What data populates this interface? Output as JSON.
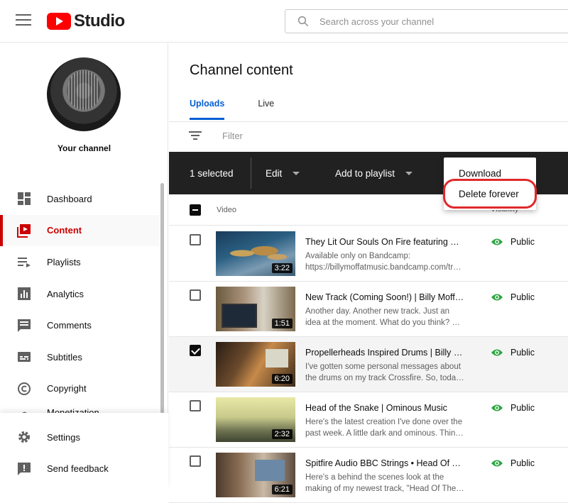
{
  "app": {
    "logo_text": "Studio"
  },
  "search": {
    "placeholder": "Search across your channel"
  },
  "sidebar": {
    "channel_label": "Your channel",
    "items": [
      {
        "label": "Dashboard",
        "icon": "dashboard-icon"
      },
      {
        "label": "Content",
        "icon": "content-icon",
        "active": true
      },
      {
        "label": "Playlists",
        "icon": "playlists-icon"
      },
      {
        "label": "Analytics",
        "icon": "analytics-icon"
      },
      {
        "label": "Comments",
        "icon": "comments-icon"
      },
      {
        "label": "Subtitles",
        "icon": "subtitles-icon"
      },
      {
        "label": "Copyright",
        "icon": "copyright-icon"
      },
      {
        "label": "Monetization",
        "icon": "monetization-icon"
      }
    ],
    "bottom": [
      {
        "label": "Settings",
        "icon": "gear-icon"
      },
      {
        "label": "Send feedback",
        "icon": "feedback-icon"
      }
    ]
  },
  "main": {
    "title": "Channel content",
    "tabs": [
      {
        "label": "Uploads",
        "active": true
      },
      {
        "label": "Live"
      }
    ],
    "filter_placeholder": "Filter",
    "action_bar": {
      "selected": "1 selected",
      "edit": "Edit",
      "add_to_playlist": "Add to playlist"
    },
    "menu": {
      "download": "Download",
      "delete_forever": "Delete forever"
    },
    "table": {
      "col_video": "Video",
      "col_visibility": "Visibility",
      "rows": [
        {
          "title": "They Lit Our Souls On Fire featuring Mike",
          "desc1": "Available only on Bandcamp:",
          "desc2": "https://billymoffatmusic.bandcamp.com/track",
          "duration": "3:22",
          "visibility": "Public",
          "checked": false
        },
        {
          "title": "New Track (Coming Soon!) | Billy Moffat Music",
          "desc1": "Another day. Another new track. Just an",
          "desc2": "idea at the moment. What do you think? Let me",
          "duration": "1:51",
          "visibility": "Public",
          "checked": false
        },
        {
          "title": "Propellerheads Inspired Drums | Billy Moffat",
          "desc1": "I've gotten some personal messages about",
          "desc2": "the drums on my track Crossfire. So, today I",
          "duration": "6:20",
          "visibility": "Public",
          "checked": true
        },
        {
          "title": "Head of the Snake | Ominous Music",
          "desc1": "Here's the latest creation I've done over the",
          "desc2": "past week. A little dark and ominous. Thinking",
          "duration": "2:32",
          "visibility": "Public",
          "checked": false
        },
        {
          "title": "Spitfire Audio BBC Strings • Head Of The Snake",
          "desc1": "Here's a behind the scenes look at the",
          "desc2": "making of my newest track, \"Head Of The Snake\"",
          "duration": "6:21",
          "visibility": "Public",
          "checked": false
        }
      ]
    }
  },
  "colors": {
    "accent_red": "#cc0000",
    "link_blue": "#065fd4",
    "public_green": "#2ba640"
  }
}
